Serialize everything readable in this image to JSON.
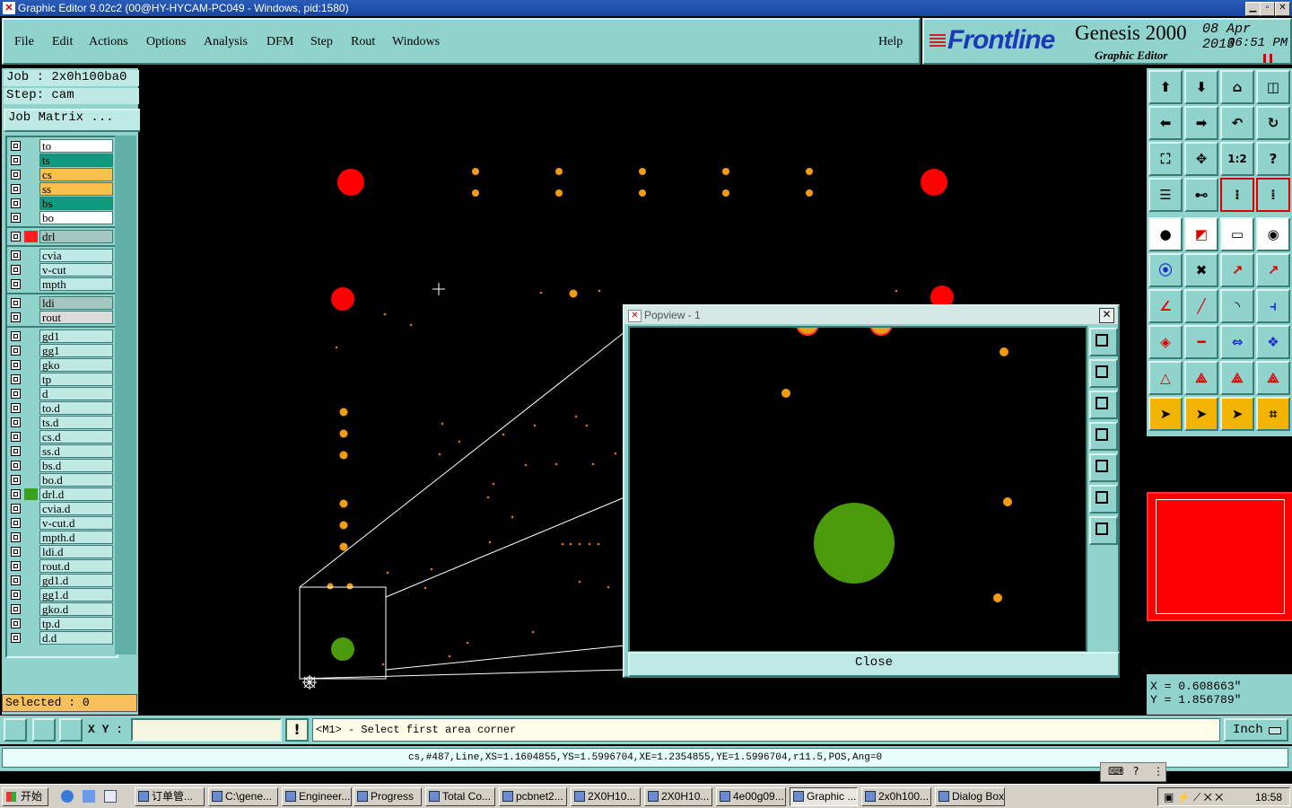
{
  "window": {
    "title": "Graphic Editor 9.02c2 (00@HY-HYCAM-PC049 - Windows, pid:1580)"
  },
  "menu": [
    "File",
    "Edit",
    "Actions",
    "Options",
    "Analysis",
    "DFM",
    "Step",
    "Rout",
    "Windows"
  ],
  "help": "Help",
  "logo": {
    "brand": "Frontline",
    "product": "Genesis 2000",
    "subtitle": "Graphic Editor",
    "date": "08 Apr 2013",
    "time": "06:51 PM"
  },
  "job": {
    "job_label": "Job : 2x0h100ba0",
    "step_label": "Step: cam",
    "matrix_button": "Job Matrix ..."
  },
  "layers": [
    {
      "name": "to",
      "color": "#ffffff",
      "group": 1
    },
    {
      "name": "ts",
      "color": "#0e9a7c",
      "group": 1
    },
    {
      "name": "cs",
      "color": "#f9c04e",
      "group": 1
    },
    {
      "name": "ss",
      "color": "#f9c04e",
      "group": 1
    },
    {
      "name": "bs",
      "color": "#0e9a7c",
      "group": 1
    },
    {
      "name": "bo",
      "color": "#ffffff",
      "group": 1
    },
    {
      "name": "drl",
      "color": "#a6c6c2",
      "group": 2,
      "active": true,
      "swatch": "#ff2020"
    },
    {
      "name": "cvia",
      "color": "#bfe9e4",
      "group": 3
    },
    {
      "name": "v-cut",
      "color": "#bfe9e4",
      "group": 3
    },
    {
      "name": "mpth",
      "color": "#bfe9e4",
      "group": 3
    },
    {
      "name": "ldi",
      "color": "#a6c6c2",
      "group": 4
    },
    {
      "name": "rout",
      "color": "#dcdcdc",
      "group": 4
    },
    {
      "name": "gd1",
      "color": "#bfe9e4",
      "group": 5
    },
    {
      "name": "gg1",
      "color": "#bfe9e4",
      "group": 5
    },
    {
      "name": "gko",
      "color": "#bfe9e4",
      "group": 5
    },
    {
      "name": "tp",
      "color": "#bfe9e4",
      "group": 5
    },
    {
      "name": "d",
      "color": "#bfe9e4",
      "group": 5
    },
    {
      "name": "to.d",
      "color": "#bfe9e4",
      "group": 5
    },
    {
      "name": "ts.d",
      "color": "#bfe9e4",
      "group": 5
    },
    {
      "name": "cs.d",
      "color": "#bfe9e4",
      "group": 5
    },
    {
      "name": "ss.d",
      "color": "#bfe9e4",
      "group": 5
    },
    {
      "name": "bs.d",
      "color": "#bfe9e4",
      "group": 5
    },
    {
      "name": "bo.d",
      "color": "#bfe9e4",
      "group": 5
    },
    {
      "name": "drl.d",
      "color": "#bfe9e4",
      "group": 5,
      "swatch": "#3aa020"
    },
    {
      "name": "cvia.d",
      "color": "#bfe9e4",
      "group": 5
    },
    {
      "name": "v-cut.d",
      "color": "#bfe9e4",
      "group": 5
    },
    {
      "name": "mpth.d",
      "color": "#bfe9e4",
      "group": 5
    },
    {
      "name": "ldi.d",
      "color": "#bfe9e4",
      "group": 5
    },
    {
      "name": "rout.d",
      "color": "#bfe9e4",
      "group": 5
    },
    {
      "name": "gd1.d",
      "color": "#bfe9e4",
      "group": 5
    },
    {
      "name": "gg1.d",
      "color": "#bfe9e4",
      "group": 5
    },
    {
      "name": "gko.d",
      "color": "#bfe9e4",
      "group": 5
    },
    {
      "name": "tp.d",
      "color": "#bfe9e4",
      "group": 5
    },
    {
      "name": "d.d",
      "color": "#bfe9e4",
      "group": 5
    }
  ],
  "selected": "Selected : 0",
  "popview": {
    "title": "Popview - 1",
    "close_label": "Close"
  },
  "coords": {
    "x": "X = 0.608663\"",
    "y": "Y = 1.856789\""
  },
  "cmdbar": {
    "xy_label": "X Y :",
    "xy_value": "",
    "prompt": "<M1> - Select first area corner",
    "units": "Inch",
    "warn": "!"
  },
  "status": "cs,#487,Line,XS=1.1604855,YS=1.5996704,XE=1.2354855,YE=1.5996704,r11.5,POS,Ang=0",
  "taskbar": {
    "start": "开始",
    "items": [
      "订单管...",
      "C:\\gene...",
      "Engineer...",
      "Progress",
      "Total Co...",
      "pcbnet2...",
      "2X0H10...",
      "2X0H10...",
      "4e00g09...",
      "Graphic ...",
      "2x0h100...",
      "Dialog Box"
    ],
    "active_index": 9,
    "clock": "18:58"
  },
  "colors": {
    "panel": "#8fd3cc",
    "pad": "#f39c12",
    "red": "#ff0000",
    "green": "#4a9a0a",
    "accent": "#1c3ab8"
  }
}
